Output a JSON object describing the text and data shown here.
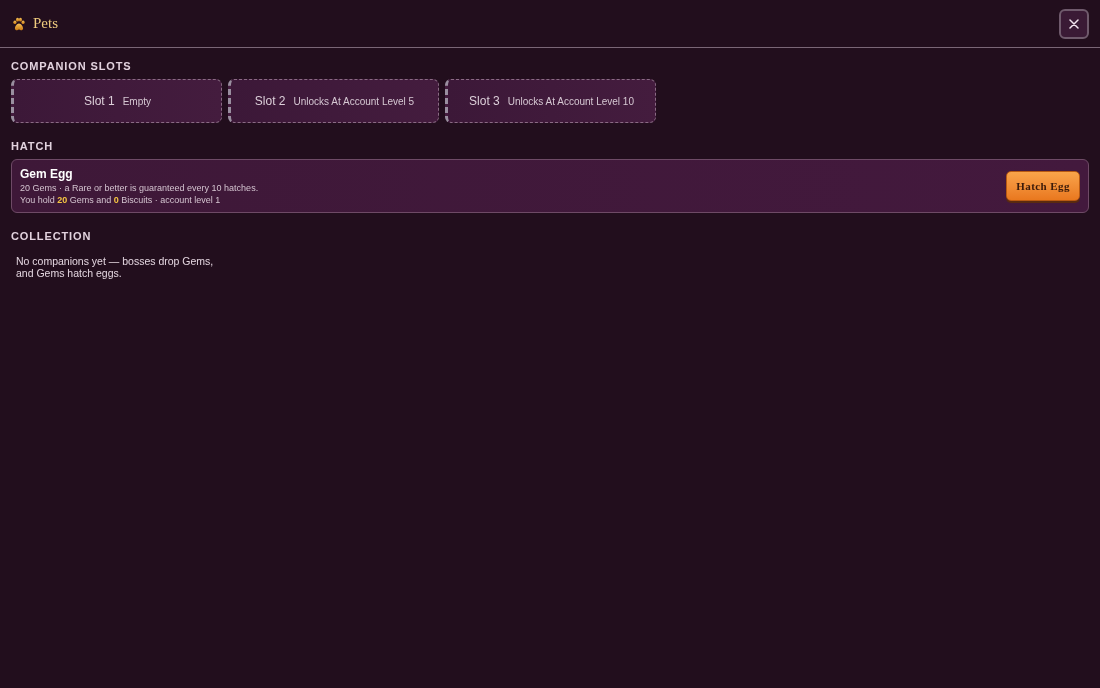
{
  "header": {
    "title": "Pets"
  },
  "sections": [
    {
      "kind": "slots",
      "heading": "COMPANION SLOTS",
      "slots": [
        {
          "label": "Slot 1",
          "status": "Empty"
        },
        {
          "label": "Slot 2",
          "status": "Unlocks At Account Level 5"
        },
        {
          "label": "Slot 3",
          "status": "Unlocks At Account Level 10"
        }
      ]
    },
    {
      "kind": "hatch",
      "heading": "HATCH",
      "card": {
        "title": "Gem Egg",
        "lines": [
          "20 Gems · a Rare or better is guaranteed every 10 hatches.",
          "You hold **20** Gems and **0** Biscuits · account level 1"
        ],
        "button": "Hatch Egg"
      }
    },
    {
      "kind": "collection",
      "heading": "COLLECTION",
      "message": "No companions yet — bosses drop Gems, and Gems hatch eggs."
    }
  ]
}
